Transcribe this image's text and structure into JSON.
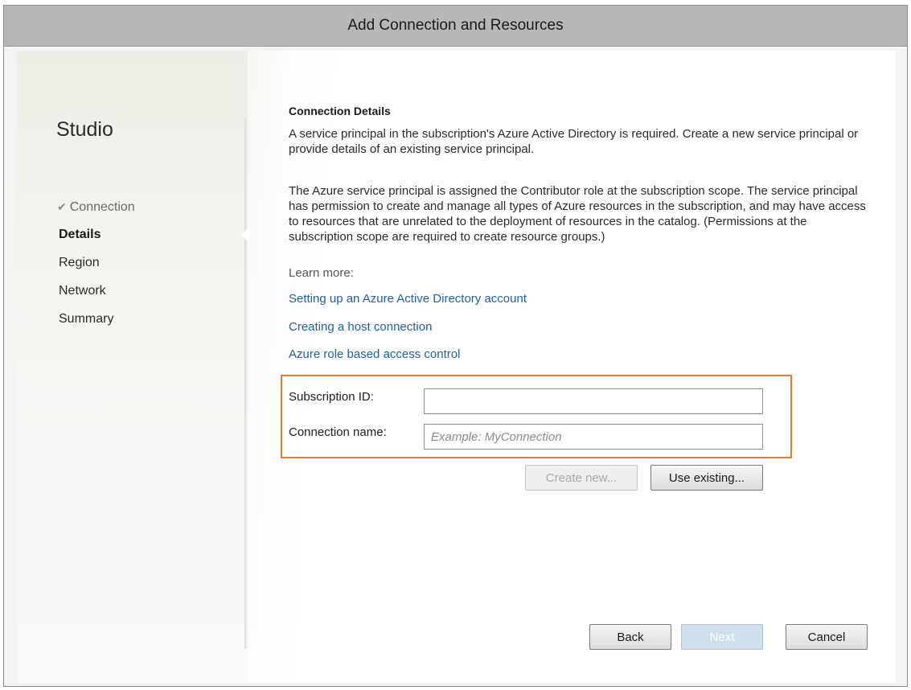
{
  "window": {
    "title": "Add Connection and Resources"
  },
  "sidebar": {
    "app_title": "Studio",
    "steps": [
      {
        "label": "Connection",
        "state": "done",
        "icon": "checkmark-icon"
      },
      {
        "label": "Details",
        "state": "current"
      },
      {
        "label": "Region",
        "state": "pending"
      },
      {
        "label": "Network",
        "state": "pending"
      },
      {
        "label": "Summary",
        "state": "pending"
      }
    ]
  },
  "main": {
    "section_title": "Connection Details",
    "paragraph1": "A service principal in the subscription's Azure Active Directory is required. Create a new service principal or provide details of an existing service principal.",
    "paragraph2": "The Azure service principal is assigned the Contributor role at the subscription scope. The service principal has permission to create and manage all types of Azure resources in the subscription, and may have access to resources that are unrelated to the deployment of resources in the catalog. (Permissions at the subscription scope are required to create resource groups.)",
    "learn_more": "Learn more:",
    "links": [
      "Setting up an Azure Active Directory account",
      "Creating a host connection",
      "Azure role based access control"
    ],
    "form": {
      "subscription_label": "Subscription ID:",
      "subscription_value": "",
      "connection_label": "Connection name:",
      "connection_value": "",
      "connection_placeholder": "Example: MyConnection",
      "highlight_color": "#e87a2e"
    },
    "create_new_label": "Create new...",
    "use_existing_label": "Use existing..."
  },
  "footer": {
    "back_label": "Back",
    "next_label": "Next",
    "cancel_label": "Cancel"
  },
  "colors": {
    "link": "#1f5fa8",
    "titlebar": "#b7b7b7"
  }
}
